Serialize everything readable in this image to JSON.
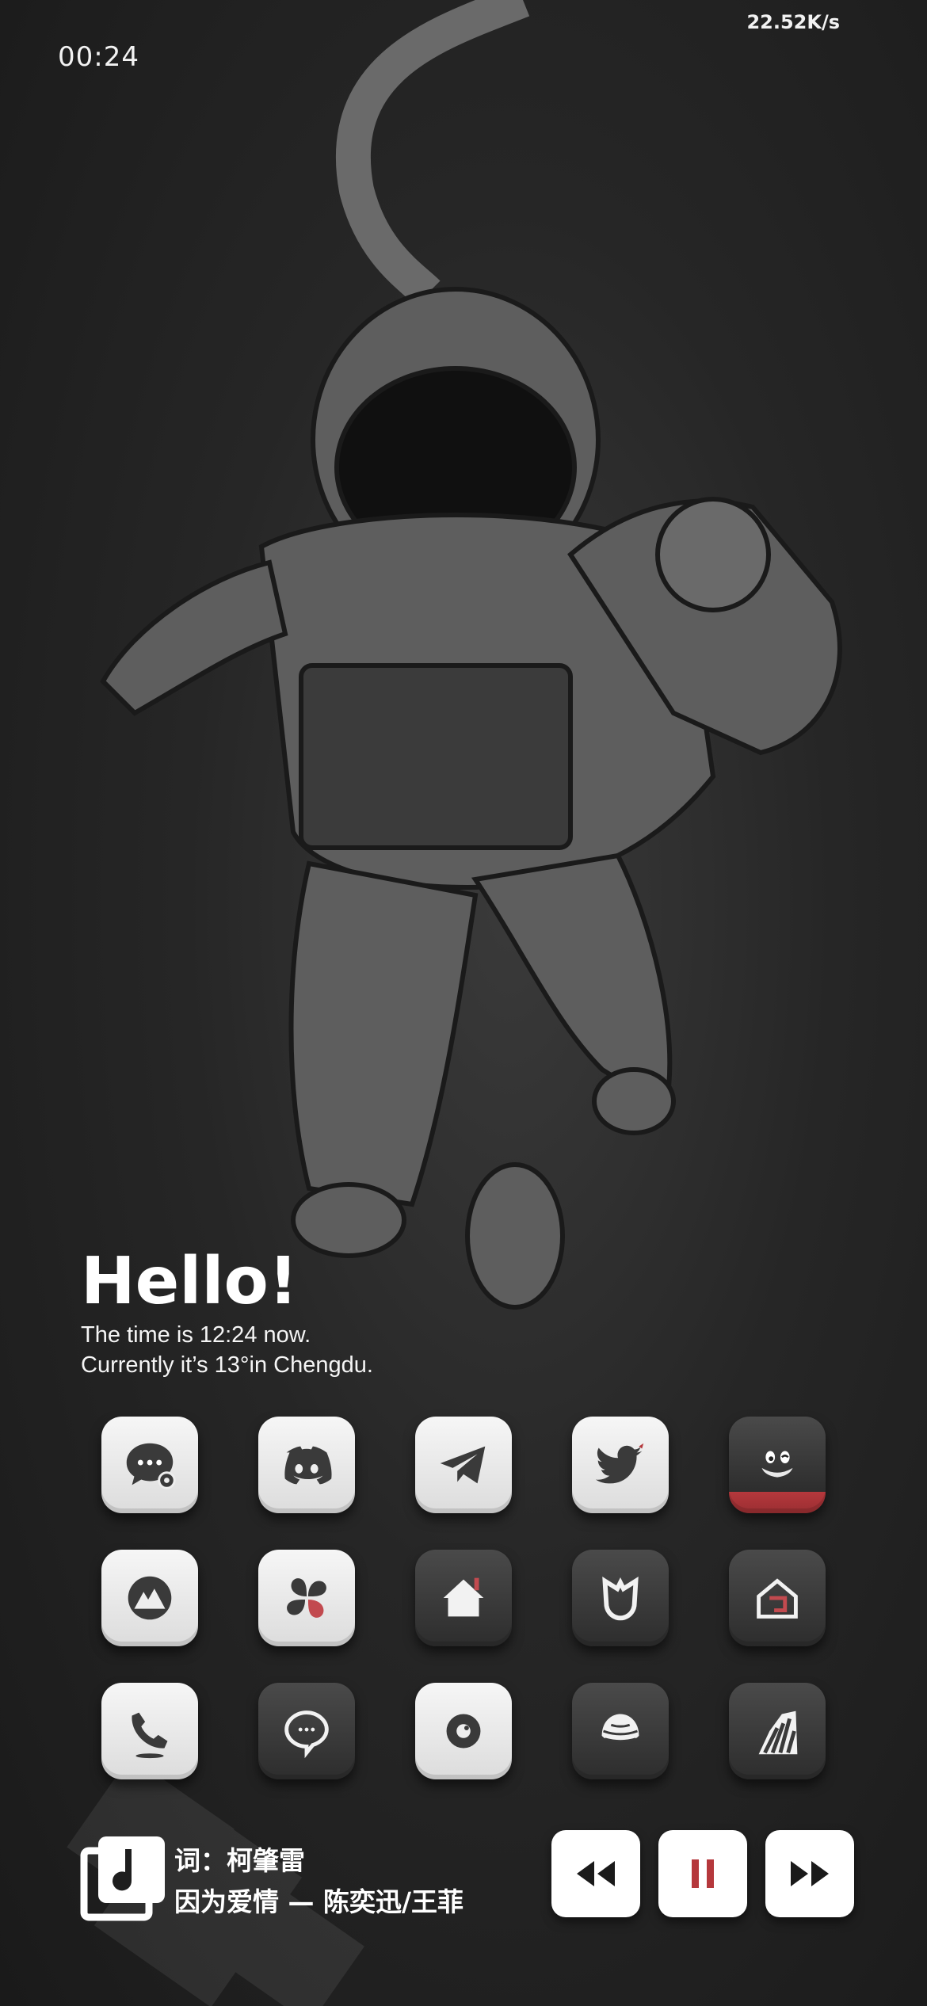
{
  "status_bar": {
    "time": "00:24",
    "net_speed": "22.52K/s"
  },
  "greeting": {
    "title": "Hello!",
    "line1": "The time is 12:24 now.",
    "line2": "Currently it’s 13°in Chengdu."
  },
  "apps": [
    {
      "icon": "messages-icon"
    },
    {
      "icon": "discord-icon"
    },
    {
      "icon": "telegram-icon"
    },
    {
      "icon": "twitter-icon"
    },
    {
      "icon": "qq-penguin-icon"
    },
    {
      "icon": "mountain-circle-icon"
    },
    {
      "icon": "clover-icon"
    },
    {
      "icon": "home-icon"
    },
    {
      "icon": "mi-home-icon"
    },
    {
      "icon": "smart-home-icon"
    },
    {
      "icon": "phone-icon"
    },
    {
      "icon": "chat-bubble-icon"
    },
    {
      "icon": "camera-lens-icon"
    },
    {
      "icon": "shell-icon"
    },
    {
      "icon": "zebra-icon"
    }
  ],
  "music": {
    "lyric": "词：柯肇雷",
    "song": "因为爱情 — 陈奕迅/王菲",
    "icon": "music-note-icon"
  },
  "controls": {
    "prev": "rewind-icon",
    "pause": "pause-icon",
    "next": "fast-forward-icon"
  },
  "colors": {
    "accent_red": "#b5383c",
    "light_tile": "#efefef",
    "dark_tile": "#3a3a3a"
  }
}
